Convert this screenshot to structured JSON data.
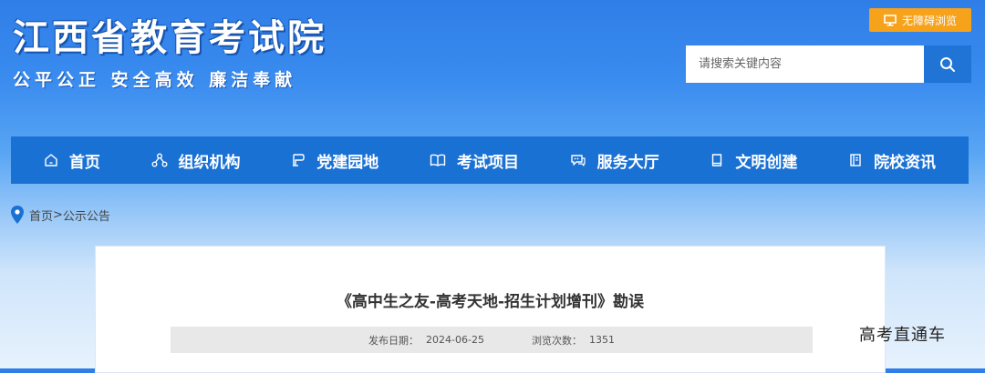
{
  "header": {
    "site_title": "江西省教育考试院",
    "slogan": "公平公正  安全高效  廉洁奉献",
    "accessibility_label": "无障碍浏览",
    "search_placeholder": "请搜索关键内容"
  },
  "nav": {
    "items": [
      {
        "label": "首页",
        "icon": "home-icon"
      },
      {
        "label": "组织机构",
        "icon": "org-chart-icon"
      },
      {
        "label": "党建园地",
        "icon": "flag-icon"
      },
      {
        "label": "考试项目",
        "icon": "open-book-icon"
      },
      {
        "label": "服务大厅",
        "icon": "chat-icon"
      },
      {
        "label": "文明创建",
        "icon": "book-icon"
      },
      {
        "label": "院校资讯",
        "icon": "document-icon"
      }
    ]
  },
  "breadcrumb": {
    "home": "首页",
    "separator": ">",
    "current": "公示公告"
  },
  "article": {
    "title": "《高中生之友-高考天地-招生计划增刊》勘误",
    "publish_label": "发布日期：",
    "publish_date": "2024-06-25",
    "views_label": "浏览次数：",
    "views_count": "1351"
  },
  "watermark": "高考直通车",
  "colors": {
    "nav_bg": "#1a71d4",
    "accessibility_bg": "#f7a21b",
    "search_button_bg": "#1f74d6",
    "location_pin": "#1a71d4"
  }
}
